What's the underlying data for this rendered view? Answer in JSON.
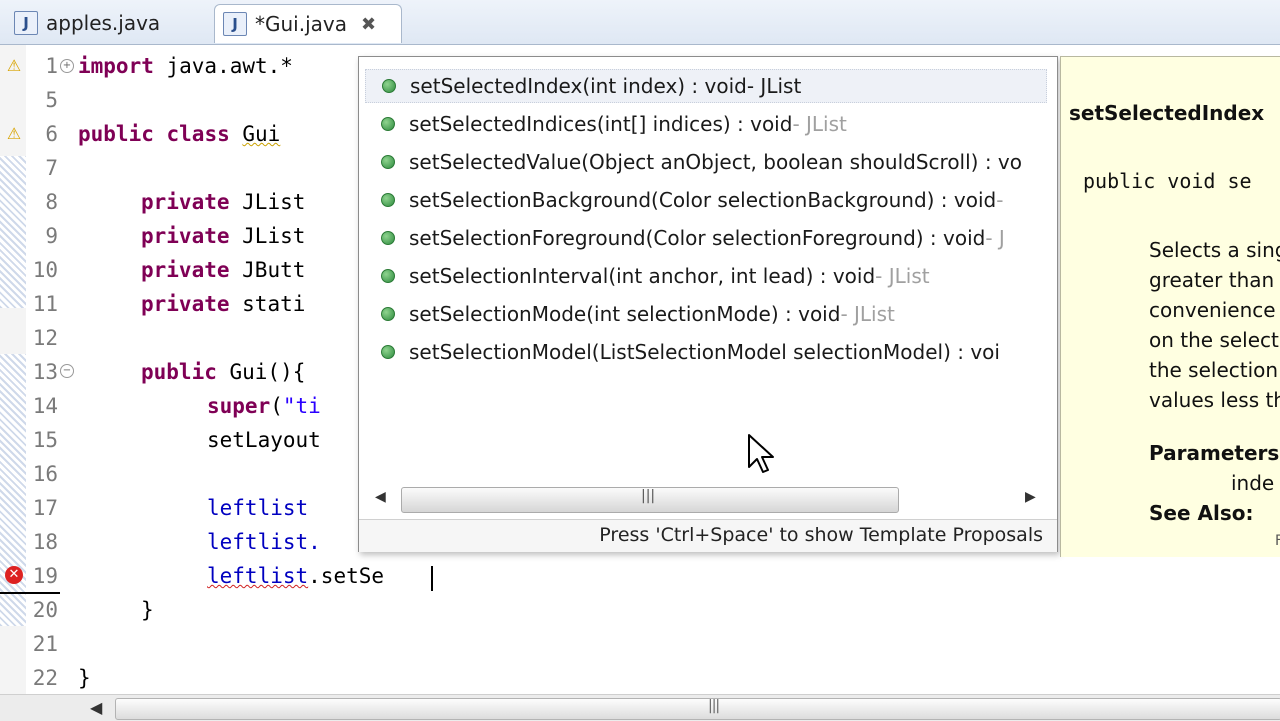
{
  "tabs": [
    {
      "label": "apples.java",
      "icon": "java-file-icon"
    },
    {
      "label": "*Gui.java",
      "icon": "java-file-icon",
      "close": "✖"
    }
  ],
  "editor": {
    "lines": [
      {
        "no": "1",
        "marker": "warning"
      },
      {
        "no": "5"
      },
      {
        "no": "6",
        "marker": "warning"
      },
      {
        "no": "7"
      },
      {
        "no": "8"
      },
      {
        "no": "9"
      },
      {
        "no": "10"
      },
      {
        "no": "11"
      },
      {
        "no": "12"
      },
      {
        "no": "13"
      },
      {
        "no": "14"
      },
      {
        "no": "15"
      },
      {
        "no": "16"
      },
      {
        "no": "17"
      },
      {
        "no": "18"
      },
      {
        "no": "19",
        "marker": "error"
      },
      {
        "no": "20"
      },
      {
        "no": "21"
      },
      {
        "no": "22"
      }
    ],
    "code": {
      "l1_kw": "import",
      "l1_rest": " java.awt.*",
      "l6_kw1": "public",
      "l6_kw2": "class",
      "l6_name": "Gui",
      "l8_kw": "private",
      "l8_rest": " JList",
      "l9_kw": "private",
      "l9_rest": " JList",
      "l10_kw": "private",
      "l10_rest": " JButt",
      "l11_kw": "private",
      "l11_rest": " stati",
      "l13_kw": "public",
      "l13_rest": " Gui(){",
      "l14_kw": "super",
      "l14_paren": "(",
      "l14_str": "\"ti",
      "l15": "setLayout",
      "l17": "leftlist",
      "l18": "leftlist.",
      "l19_obj": "leftlist",
      "l19_rest": ".setSe",
      "l20": "}",
      "l22": "}"
    }
  },
  "proposals": {
    "items": [
      {
        "sig": "setSelectedIndex(int index) : void",
        "decl": " - JList",
        "selected": true
      },
      {
        "sig": "setSelectedIndices(int[] indices) : void",
        "decl": " - JList"
      },
      {
        "sig": "setSelectedValue(Object anObject, boolean shouldScroll) : vo",
        "decl": ""
      },
      {
        "sig": "setSelectionBackground(Color selectionBackground) : void",
        "decl": " -"
      },
      {
        "sig": "setSelectionForeground(Color selectionForeground) : void",
        "decl": " - J"
      },
      {
        "sig": "setSelectionInterval(int anchor, int lead) : void",
        "decl": " - JList"
      },
      {
        "sig": "setSelectionMode(int selectionMode) : void",
        "decl": " - JList"
      },
      {
        "sig": "setSelectionModel(ListSelectionModel selectionModel) : voi",
        "decl": ""
      }
    ],
    "status": "Press 'Ctrl+Space' to show Template Proposals",
    "scroll_left": "◀",
    "scroll_right": "▶",
    "grip": "|||"
  },
  "javadoc": {
    "title": "setSelectedIndex",
    "signature": "public void se",
    "description": [
      "Selects a sing",
      "greater than",
      "convenience",
      "on the select",
      "the selection",
      "values less th"
    ],
    "params_label": "Parameters:",
    "param_name": "inde",
    "see_also": "See Also:",
    "corner": "F"
  },
  "hscroll": {
    "left": "◀",
    "grip": "|||"
  }
}
